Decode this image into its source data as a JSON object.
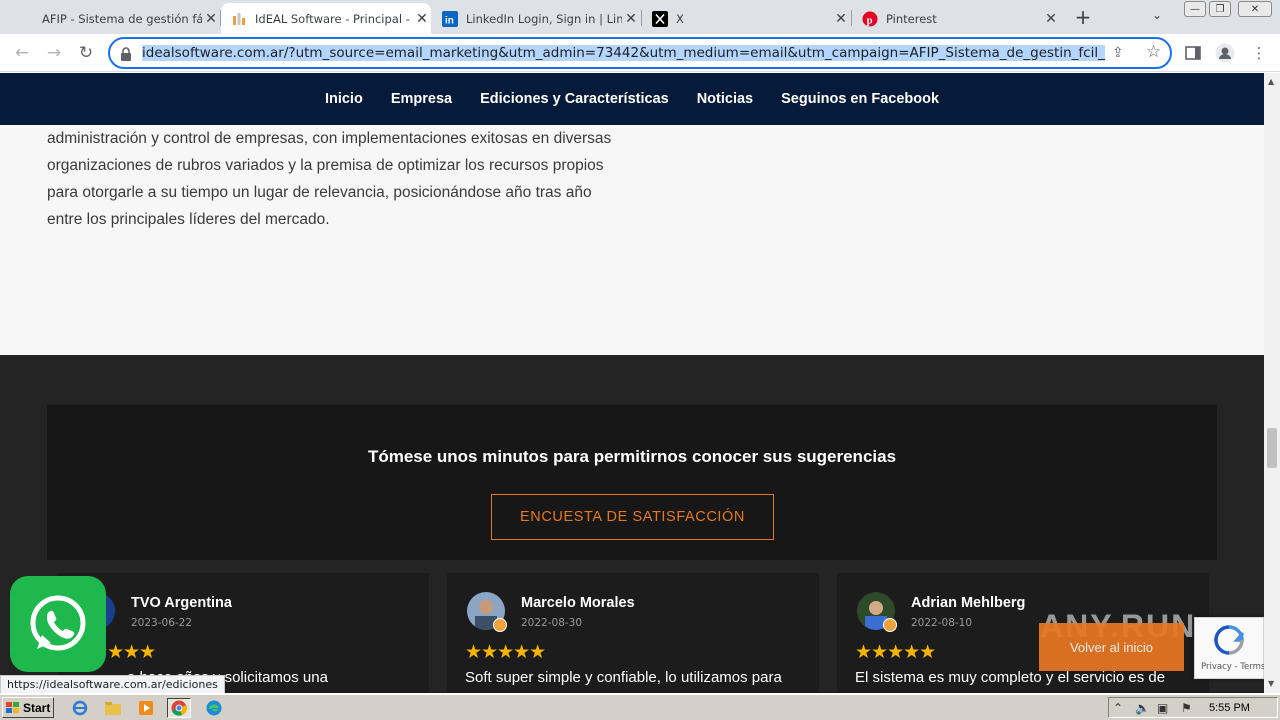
{
  "browser": {
    "tabs": [
      {
        "title": "AFIP - Sistema de gestión fácil",
        "icon": "afip-favicon"
      },
      {
        "title": "IdEAL Software - Principal - Sis",
        "icon": "ideal-favicon"
      },
      {
        "title": "LinkedIn Login, Sign in | Linked",
        "icon": "linkedin-favicon"
      },
      {
        "title": "X",
        "icon": "x-favicon"
      },
      {
        "title": "Pinterest",
        "icon": "pinterest-favicon"
      }
    ],
    "active_tab": 1,
    "new_tab_label": "+",
    "url": "idealsoftware.com.ar/?utm_source=email_marketing&utm_admin=73442&utm_medium=email&utm_campaign=AFIP_Sistema_de_gestin_fcil_Pagos_Cobranzas"
  },
  "site": {
    "nav": [
      "Inicio",
      "Empresa",
      "Ediciones y Características",
      "Noticias",
      "Seguinos en Facebook"
    ],
    "about_lines": [
      "administración y control de empresas, con implementaciones exitosas en diversas",
      "organizaciones de rubros variados y la premisa de optimizar los recursos propios",
      "para otorgarle a su tiempo un lugar de relevancia, posicionándose año tras año",
      "entre los principales líderes del mercado."
    ],
    "survey": {
      "heading": "Tómese unos minutos para permitirnos conocer sus sugerencias",
      "button": "ENCUESTA DE SATISFACCIÓN"
    },
    "reviews": [
      {
        "name": "TVO Argentina",
        "date": "2023-06-22",
        "stars": "★★★★★",
        "text": "a hace años y solicitamos una"
      },
      {
        "name": "Marcelo Morales",
        "date": "2022-08-30",
        "stars": "★★★★★",
        "text": "Soft super simple y confiable, lo utilizamos para"
      },
      {
        "name": "Adrian Mehlberg",
        "date": "2022-08-10",
        "stars": "★★★★★",
        "text": "El sistema es muy completo y el servicio es de"
      }
    ],
    "back_to_top": "Volver al inicio",
    "watermark": "ANY.RUN",
    "recaptcha_terms": "Privacy - Terms"
  },
  "status_url": "https://idealsoftware.com.ar/ediciones",
  "taskbar": {
    "start": "Start",
    "clock": "5:55 PM"
  },
  "colors": {
    "nav_bg": "#061a3a",
    "accent": "#e87722",
    "star": "#f7b500",
    "dark_section": "#242424",
    "whatsapp": "#1fb84e"
  }
}
